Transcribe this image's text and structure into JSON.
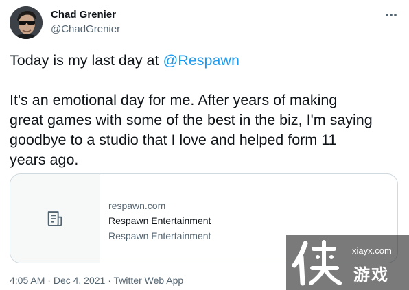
{
  "author": {
    "name": "Chad Grenier",
    "handle": "@ChadGrenier"
  },
  "more_icon": "more-horizontal-icon",
  "tweet": {
    "line1_prefix": "Today is my last day at ",
    "mention": "@Respawn",
    "paragraph2_lines": [
      "It's an emotional day for me. After years of making",
      "great games with some of the best in the biz, I'm saying",
      "goodbye to a studio that I love and helped form 11",
      "years ago."
    ]
  },
  "link_card": {
    "icon": "article-icon",
    "domain": "respawn.com",
    "title": "Respawn Entertainment",
    "description": "Respawn Entertainment"
  },
  "meta": {
    "time": "4:05 AM",
    "date": "Dec 4, 2021",
    "client": "Twitter Web App",
    "separator": " · "
  },
  "watermark": {
    "site": "xiayx.com",
    "text": "游戏"
  },
  "colors": {
    "text": "#0f1419",
    "secondary": "#536471",
    "link": "#1d9bf0",
    "border": "#cfd9de"
  }
}
